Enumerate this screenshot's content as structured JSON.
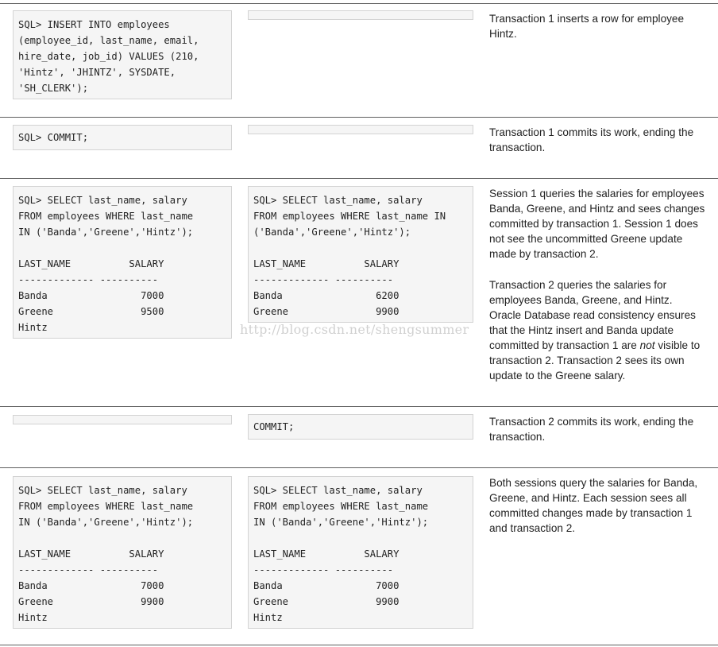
{
  "rows": [
    {
      "session1": "SQL> INSERT INTO employees\n(employee_id, last_name, email,\nhire_date, job_id) VALUES (210,\n'Hintz', 'JHINTZ', SYSDATE,\n'SH_CLERK');",
      "session2": "",
      "description": "Transaction 1 inserts a row for employee Hintz."
    },
    {
      "session1": "SQL> COMMIT;",
      "session2": "",
      "description": "Transaction 1 commits its work, ending the transaction."
    },
    {
      "session1": "SQL> SELECT last_name, salary\nFROM employees WHERE last_name\nIN ('Banda','Greene','Hintz');\n\nLAST_NAME          SALARY\n------------- ----------\nBanda                7000\nGreene               9500\nHintz",
      "session2": "SQL> SELECT last_name, salary\nFROM employees WHERE last_name IN\n('Banda','Greene','Hintz');\n\nLAST_NAME          SALARY\n------------- ----------\nBanda                6200\nGreene               9900",
      "description": "Session 1 queries the salaries for employees Banda, Greene, and Hintz and sees changes committed by transaction 1. Session 1 does not see the uncommitted Greene update made by transaction 2.",
      "description2_before": "Transaction 2 queries the salaries for employees Banda, Greene, and Hintz. Oracle Database read consistency ensures that the Hintz insert and Banda update committed by transaction 1 are ",
      "description2_em": "not",
      "description2_after": " visible to transaction 2. Transaction 2 sees its own update to the Greene salary."
    },
    {
      "session1": "",
      "session2": "COMMIT;",
      "description": "Transaction 2 commits its work, ending the transaction."
    },
    {
      "session1": "SQL> SELECT last_name, salary\nFROM employees WHERE last_name\nIN ('Banda','Greene','Hintz');\n\nLAST_NAME          SALARY\n------------- ----------\nBanda                7000\nGreene               9900\nHintz",
      "session2": "SQL> SELECT last_name, salary\nFROM employees WHERE last_name\nIN ('Banda','Greene','Hintz');\n\nLAST_NAME          SALARY\n------------- ----------\nBanda                7000\nGreene               9900\nHintz",
      "description": "Both sessions query the salaries for Banda, Greene, and Hintz. Each session sees all committed changes made by transaction 1 and transaction 2."
    }
  ],
  "watermark": "http://blog.csdn.net/shengsummer"
}
